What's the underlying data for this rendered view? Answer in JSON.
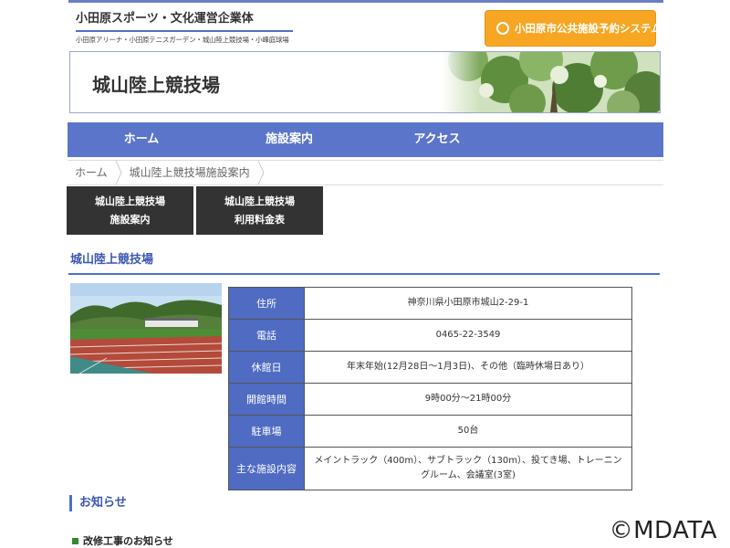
{
  "header": {
    "brand_title": "小田原スポーツ・文化運営企業体",
    "brand_sub": "小田原アリーナ・小田原テニスガーデン・城山陸上競技場・小峰庭球場",
    "reserve_button": "小田原市公共施設予約システム"
  },
  "hero": {
    "title": "城山陸上競技場"
  },
  "nav": {
    "items": [
      {
        "label": "ホーム"
      },
      {
        "label": "施設案内"
      },
      {
        "label": "アクセス"
      }
    ]
  },
  "breadcrumb": {
    "items": [
      {
        "label": "ホーム"
      },
      {
        "label": "城山陸上競技場施設案内"
      }
    ]
  },
  "subtabs": [
    {
      "line1": "城山陸上競技場",
      "line2": "施設案内"
    },
    {
      "line1": "城山陸上競技場",
      "line2": "利用料金表"
    }
  ],
  "section": {
    "title": "城山陸上競技場"
  },
  "info": {
    "rows": [
      {
        "label": "住所",
        "value": "神奈川県小田原市城山2-29-1"
      },
      {
        "label": "電話",
        "value": "0465-22-3549"
      },
      {
        "label": "休館日",
        "value": "年末年始(12月28日～1月3日)、その他（臨時休場日あり）"
      },
      {
        "label": "開館時間",
        "value": "9時00分～21時00分"
      },
      {
        "label": "駐車場",
        "value": "50台"
      },
      {
        "label": "主な施設内容",
        "value": "メイントラック（400m）、サブトラック（130m）、投てき場、トレーニングルーム、会議室(3室)"
      }
    ]
  },
  "news": {
    "title": "お知らせ",
    "items": [
      {
        "label": "改修工事のお知らせ"
      }
    ]
  },
  "watermark": "©MDATA",
  "colors": {
    "nav": "#5a75c9",
    "accent_blue": "#3b56b0",
    "reserve_orange": "#f6a623",
    "subtab_dark": "#333333",
    "bullet_green": "#2e8b2e"
  }
}
